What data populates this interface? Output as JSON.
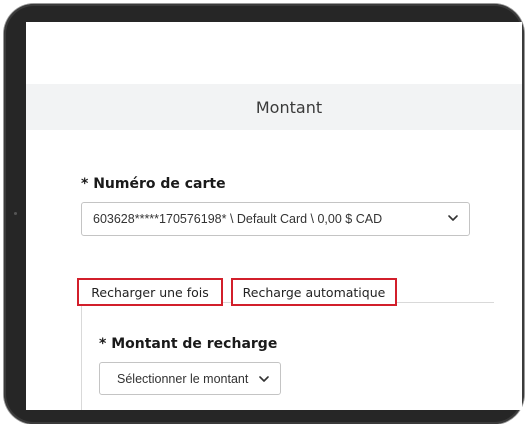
{
  "header": {
    "title": "Montant"
  },
  "card": {
    "label": "* Numéro de carte",
    "selected_value": "603628*****170576198* \\ Default Card \\ 0,00 $ CAD",
    "dropdown_icon": "chevron-down-icon"
  },
  "tabs": [
    {
      "label": "Recharger une fois",
      "highlight_color": "#d21f2b"
    },
    {
      "label": "Recharge automatique",
      "highlight_color": "#d21f2b"
    }
  ],
  "recharge": {
    "label": "* Montant de recharge",
    "selected_value": "Sélectionner le montant",
    "dropdown_icon": "chevron-down-icon"
  }
}
